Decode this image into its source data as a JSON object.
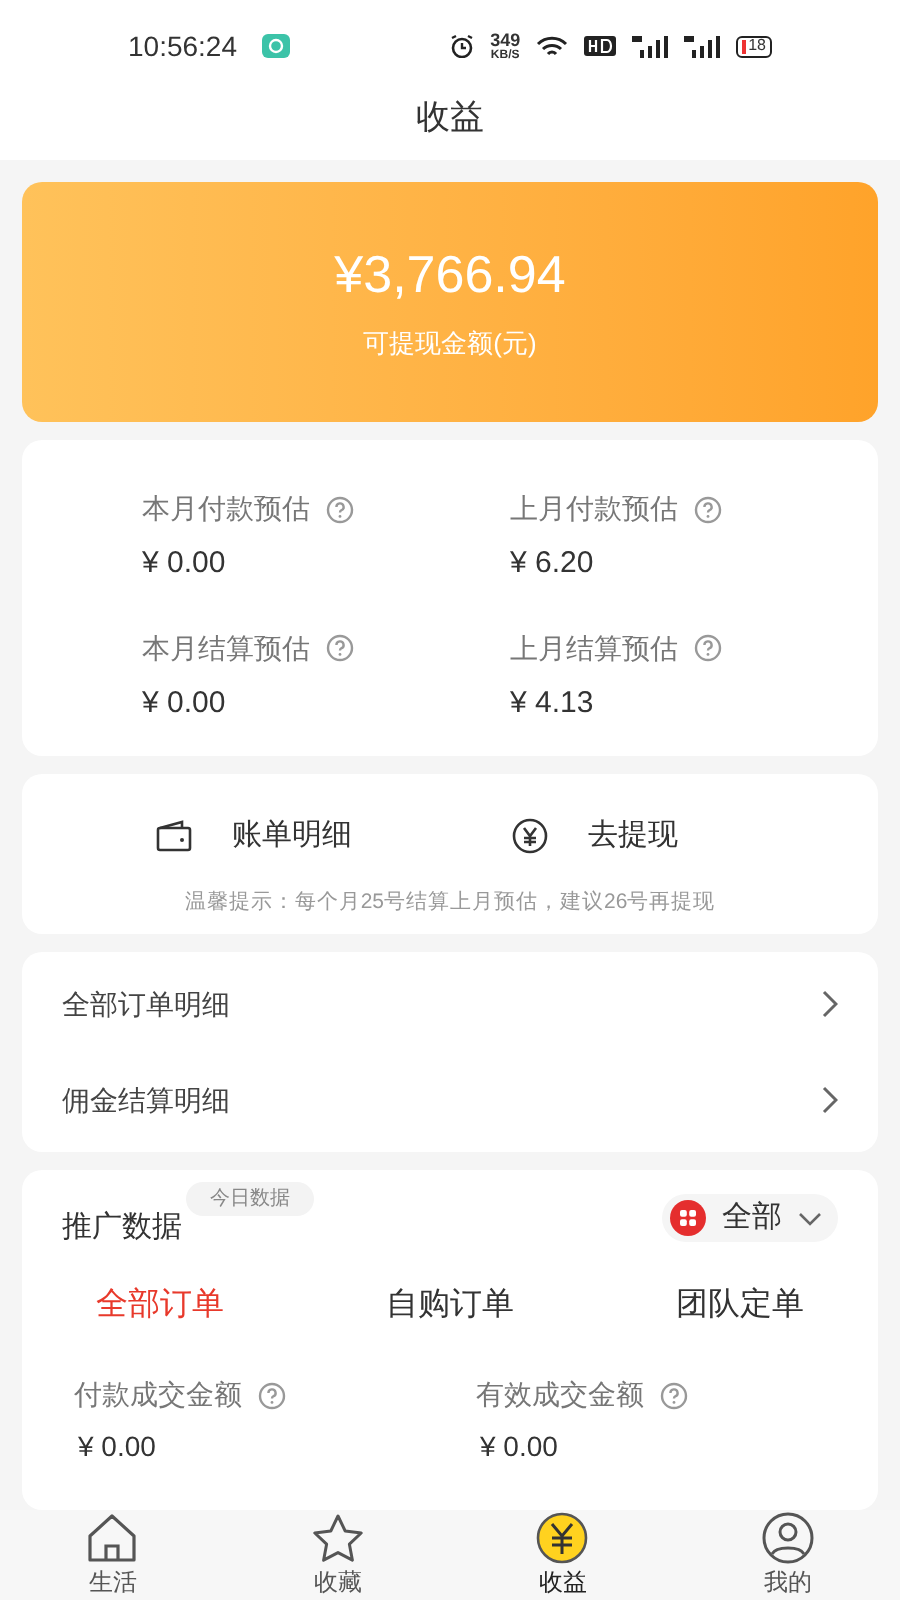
{
  "status_bar": {
    "time": "10:56:24",
    "speed": "349",
    "speed_unit": "KB/S",
    "battery": "18"
  },
  "title": "收益",
  "balance": {
    "amount": "¥3,766.94",
    "label": "可提现金额(元)"
  },
  "estimates": [
    {
      "label": "本月付款预估",
      "value": "¥ 0.00"
    },
    {
      "label": "上月付款预估",
      "value": "¥ 6.20"
    },
    {
      "label": "本月结算预估",
      "value": "¥ 0.00"
    },
    {
      "label": "上月结算预估",
      "value": "¥ 4.13"
    }
  ],
  "actions": [
    {
      "kind": "wallet",
      "label": "账单明细"
    },
    {
      "kind": "coin",
      "label": "去提现"
    }
  ],
  "tip": "温馨提示：每个月25号结算上月预估，建议26号再提现",
  "links": [
    "全部订单明细",
    "佣金结算明细"
  ],
  "promo": {
    "title": "推广数据",
    "badge": "今日数据",
    "filter": "全部",
    "tabs": [
      {
        "label": "全部订单",
        "selected": true
      },
      {
        "label": "自购订单",
        "selected": false
      },
      {
        "label": "团队定单",
        "selected": false
      }
    ],
    "metrics": [
      {
        "label": "付款成交金额",
        "value": "¥ 0.00"
      },
      {
        "label": "有效成交金额",
        "value": "¥ 0.00"
      }
    ]
  },
  "nav": [
    {
      "kind": "home",
      "label": "生活",
      "selected": false
    },
    {
      "kind": "star",
      "label": "收藏",
      "selected": false
    },
    {
      "kind": "yuan",
      "label": "收益",
      "selected": true
    },
    {
      "kind": "user",
      "label": "我的",
      "selected": false
    }
  ]
}
